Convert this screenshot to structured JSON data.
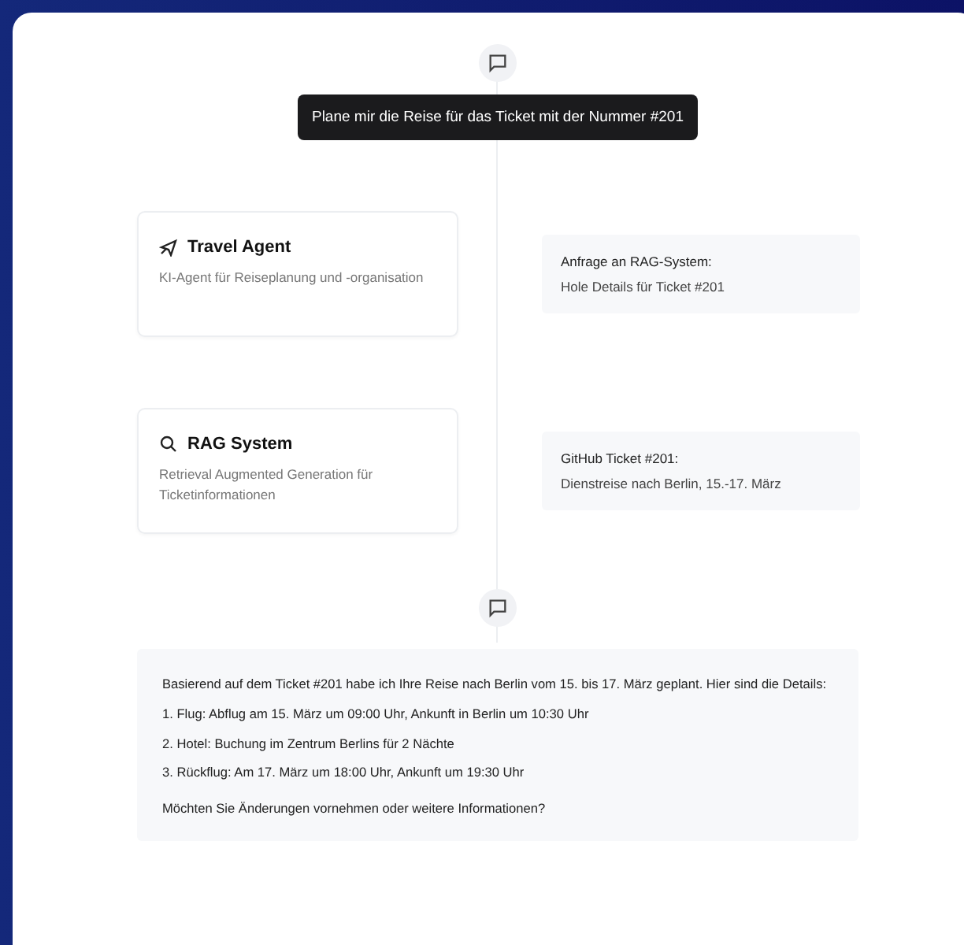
{
  "prompt": "Plane mir die Reise für das Ticket mit der Nummer #201",
  "steps": [
    {
      "agent": {
        "kind": "travel",
        "title": "Travel Agent",
        "description": "KI-Agent für Reiseplanung und -organisation"
      },
      "message": {
        "title": "Anfrage an RAG-System:",
        "text": "Hole Details für Ticket #201"
      }
    },
    {
      "agent": {
        "kind": "search",
        "title": "RAG System",
        "description": "Retrieval Augmented Generation für Ticketinformationen"
      },
      "message": {
        "title": "GitHub Ticket #201:",
        "text": "Dienstreise nach Berlin, 15.-17. März"
      }
    }
  ],
  "answer": {
    "intro": "Basierend auf dem Ticket #201 habe ich Ihre Reise nach Berlin vom 15. bis 17. März geplant. Hier sind die Details:",
    "items": [
      "1. Flug: Abflug am 15. März um 09:00 Uhr, Ankunft in Berlin um 10:30 Uhr",
      "2. Hotel: Buchung im Zentrum Berlins für 2 Nächte",
      "3. Rückflug: Am 17. März um 18:00 Uhr, Ankunft um 19:30 Uhr"
    ],
    "outro": "Möchten Sie Änderungen vornehmen oder weitere Informationen?"
  }
}
